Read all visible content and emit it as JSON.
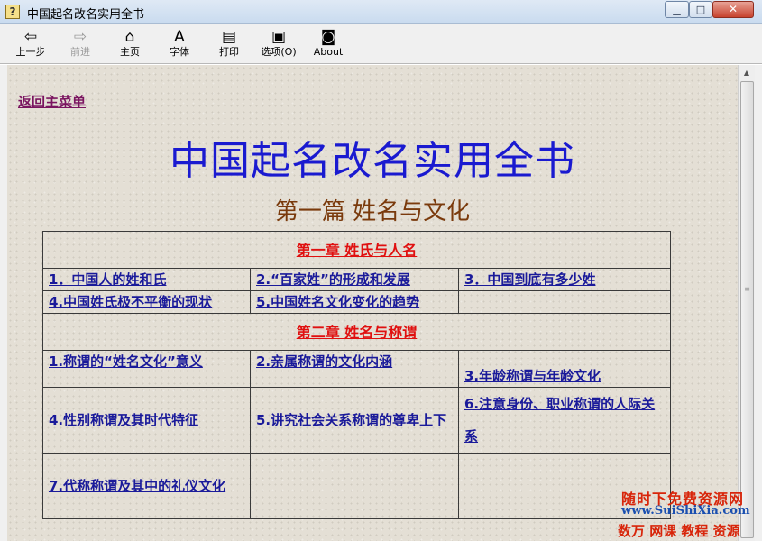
{
  "window": {
    "title": "中国起名改名实用全书",
    "app_icon": "help-book-icon",
    "minimize": "minimize-icon",
    "maximize": "maximize-icon",
    "close": "close-icon"
  },
  "toolbar": {
    "back": "上一步",
    "forward": "前进",
    "home": "主页",
    "font": "字体",
    "print": "打印",
    "options": "选项(O)",
    "about": "About"
  },
  "page": {
    "back_menu": "返回主菜单",
    "title": "中国起名改名实用全书",
    "part_title": "第一篇  姓名与文化"
  },
  "toc": {
    "ch1": {
      "title": "第一章  姓氏与人名",
      "items": [
        "1．中国人的姓和氏",
        "2.“百家姓”的形成和发展",
        "3．中国到底有多少姓",
        "4.中国姓氏极不平衡的现状",
        "5.中国姓名文化变化的趋势"
      ]
    },
    "ch2": {
      "title": "第二章  姓名与称谓",
      "items": [
        "1.称谓的“姓名文化”意义",
        "2.亲属称谓的文化内涵",
        "3.年龄称谓与年龄文化",
        "4.性别称谓及其时代特征",
        "5.讲究社会关系称谓的尊卑上下",
        "6.注意身份、职业称谓的人际关系",
        "7.代称称谓及其中的礼仪文化"
      ]
    }
  },
  "watermark": {
    "line1": "随时下免费资源网",
    "line2": "www.SuiShiXia.com",
    "line3": "数万 网课 教程 资源"
  },
  "colors": {
    "title_blue": "#1a1ad0",
    "chapter_red": "#e01010",
    "link_blue": "#1a1a9a",
    "back_link": "#7a1460"
  }
}
